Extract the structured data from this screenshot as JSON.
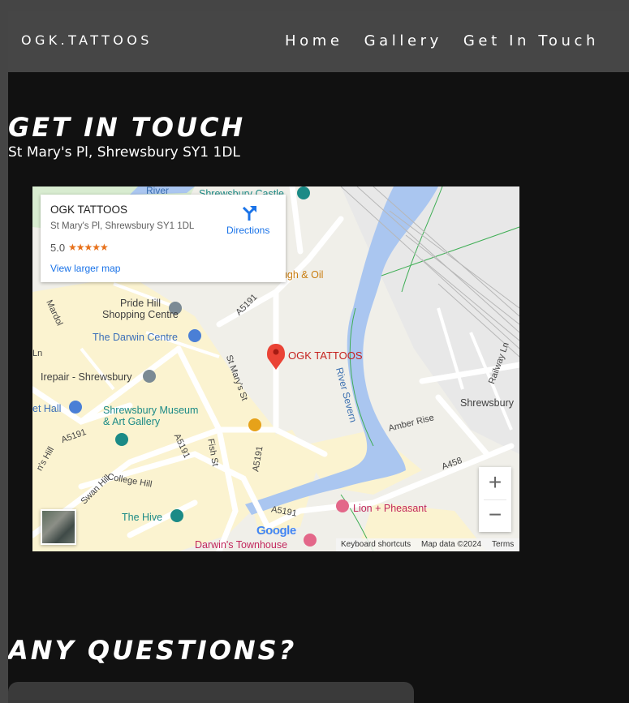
{
  "nav": {
    "brand": "OGK.TATTOOS",
    "links": [
      "Home",
      "Gallery",
      "Get In Touch"
    ]
  },
  "contact": {
    "heading": "GET IN TOUCH",
    "address": "St Mary's Pl, Shrewsbury SY1 1DL"
  },
  "map": {
    "card": {
      "name": "OGK TATTOOS",
      "address": "St Mary's Pl, Shrewsbury SY1 1DL",
      "rating": "5.0",
      "stars": "★★★★★",
      "larger_map": "View larger map",
      "directions": "Directions"
    },
    "pin_label": "OGK TATTOOS",
    "labels": {
      "river": "River Severn",
      "pride_hill": "Pride Hill",
      "shopping_centre": "Shopping Centre",
      "darwin_centre": "The Darwin Centre",
      "irepair": "Irepair - Shrewsbury",
      "museum_1": "Shrewsbury Museum",
      "museum_2": "& Art Gallery",
      "hive": "The Hive",
      "lion": "Lion + Pheasant",
      "townhouse": "Darwin's Townhouse",
      "dough": "ough & Oil",
      "castle": "Shrewsbury Castle",
      "shrewsbury": "Shrewsbury",
      "amber": "Amber Rise",
      "railway": "Railway Ln",
      "a5191_1": "A5191",
      "a5191_2": "A5191",
      "a5191_3": "A5191",
      "a5191_4": "A5191",
      "a5191_5": "A5191",
      "a458": "A458",
      "st_marys": "St Mary's St",
      "fish_st": "Fish St",
      "college_hill": "College Hill",
      "swan_hill": "Swan Hill",
      "mardol": "Mardol",
      "et_hall": "et Hall",
      "ns_hill": "n's Hill",
      "ln": "Ln",
      "river_top": "River"
    },
    "zoom_in": "+",
    "zoom_out": "−",
    "google": "Google",
    "attribution": {
      "shortcuts": "Keyboard shortcuts",
      "data": "Map data ©2024",
      "terms": "Terms"
    }
  },
  "questions": {
    "heading": "ANY QUESTIONS?"
  }
}
